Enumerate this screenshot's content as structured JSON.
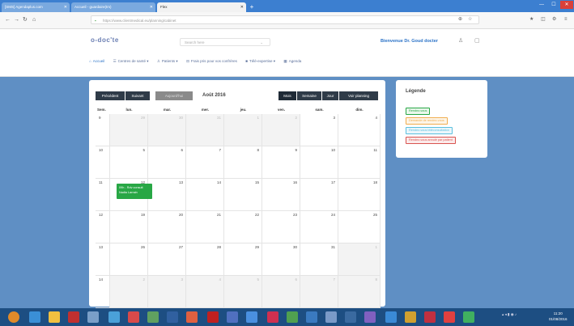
{
  "browser": {
    "tabs": [
      {
        "label": "[SMS] Agendaplus.com",
        "active": false
      },
      {
        "label": "Accueil - guardaire(tm)",
        "active": false
      },
      {
        "label": "Flex",
        "active": true
      }
    ],
    "url": "https://www.clientmedical.eu/planning/cabinet"
  },
  "site": {
    "logo": "o-doc'te",
    "search_placeholder": "Search here",
    "welcome": "Bienvenue Dr. Goud docter",
    "nav": [
      {
        "icon": "home-icon",
        "label": "Accueil",
        "active": true
      },
      {
        "icon": "list-icon",
        "label": "Centres de santé",
        "active": false
      },
      {
        "icon": "user-icon",
        "label": "Patients",
        "active": false
      },
      {
        "icon": "money-icon",
        "label": "Frais pris pour vos confrères",
        "active": false
      },
      {
        "icon": "briefcase-icon",
        "label": "Télé-expertise",
        "active": false
      },
      {
        "icon": "calendar-icon",
        "label": "Agenda",
        "active": false
      }
    ]
  },
  "calendar": {
    "prev_label": "Précédent",
    "next_label": "Suivant",
    "today_label": "Aujourd'hui",
    "title": "Août 2016",
    "view_buttons": [
      "Mois",
      "Semaine",
      "Jour",
      "Voir planning"
    ],
    "headers": [
      "Sem.",
      "lun.",
      "mar.",
      "mer.",
      "jeu.",
      "ven.",
      "sam.",
      "dim."
    ],
    "weeks": [
      {
        "week": "9",
        "days": [
          {
            "d": "29",
            "other": true
          },
          {
            "d": "30",
            "other": true
          },
          {
            "d": "31",
            "other": true
          },
          {
            "d": "1",
            "other": true
          },
          {
            "d": "2",
            "other": true
          },
          {
            "d": "3",
            "other": false
          },
          {
            "d": "4",
            "other": false
          }
        ]
      },
      {
        "week": "10",
        "days": [
          {
            "d": "5",
            "other": false
          },
          {
            "d": "6",
            "other": false
          },
          {
            "d": "7",
            "other": false
          },
          {
            "d": "8",
            "other": false
          },
          {
            "d": "9",
            "other": false
          },
          {
            "d": "10",
            "other": false
          },
          {
            "d": "11",
            "other": false
          }
        ]
      },
      {
        "week": "11",
        "days": [
          {
            "d": "12",
            "other": false
          },
          {
            "d": "13",
            "other": false
          },
          {
            "d": "14",
            "other": false
          },
          {
            "d": "15",
            "other": false
          },
          {
            "d": "16",
            "other": false
          },
          {
            "d": "17",
            "other": false
          },
          {
            "d": "18",
            "other": false
          }
        ]
      },
      {
        "week": "12",
        "days": [
          {
            "d": "19",
            "other": false
          },
          {
            "d": "20",
            "other": false
          },
          {
            "d": "21",
            "other": false
          },
          {
            "d": "22",
            "other": false
          },
          {
            "d": "23",
            "other": false
          },
          {
            "d": "24",
            "other": false
          },
          {
            "d": "25",
            "other": false
          }
        ]
      },
      {
        "week": "13",
        "days": [
          {
            "d": "26",
            "other": false
          },
          {
            "d": "27",
            "other": false
          },
          {
            "d": "28",
            "other": false
          },
          {
            "d": "29",
            "other": false
          },
          {
            "d": "30",
            "other": false
          },
          {
            "d": "31",
            "other": false
          },
          {
            "d": "1",
            "other": true
          }
        ]
      },
      {
        "week": "14",
        "days": [
          {
            "d": "2",
            "other": true
          },
          {
            "d": "3",
            "other": true
          },
          {
            "d": "4",
            "other": true
          },
          {
            "d": "5",
            "other": true
          },
          {
            "d": "6",
            "other": true
          },
          {
            "d": "7",
            "other": true
          },
          {
            "d": "8",
            "other": true
          }
        ]
      }
    ],
    "event": {
      "line1": "09h - Rdv consult",
      "line2": "Nadia Larrain",
      "color": "#28a745"
    }
  },
  "legend": {
    "title": "Légende",
    "items": [
      {
        "label": "Rendez-vous",
        "color": "#28a745",
        "bg": "#eaf7ec"
      },
      {
        "label": "Demande de rendez-vous",
        "color": "#f0ad4e",
        "bg": "#fdf5e8"
      },
      {
        "label": "Rendez-vous téléconsultation",
        "color": "#5bc0de",
        "bg": "#eaf6fb"
      },
      {
        "label": "Rendez-vous annulé par patient",
        "color": "#d9534f",
        "bg": "#fbeaea"
      }
    ]
  },
  "taskbar": {
    "clock_time": "11:20",
    "clock_date": "01/08/2016"
  }
}
